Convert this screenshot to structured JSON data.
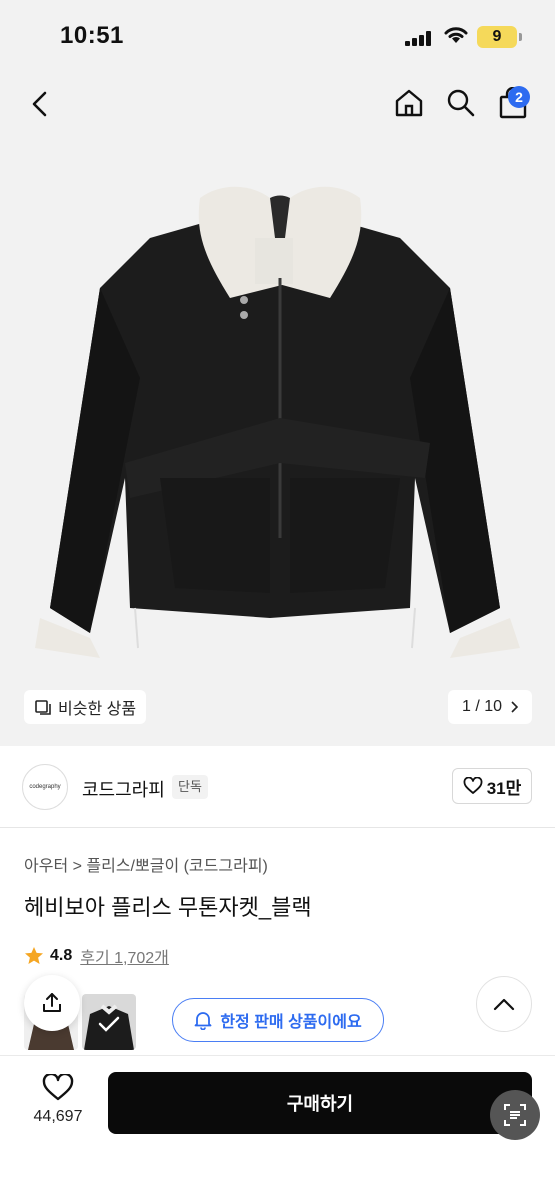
{
  "status": {
    "time": "10:51",
    "battery": "9"
  },
  "header": {
    "cart_count": "2"
  },
  "gallery": {
    "similar_label": "비슷한 상품",
    "pager": "1 / 10"
  },
  "brand": {
    "logo_text": "codegraphy",
    "name": "코드그라피",
    "tag": "단독",
    "likes": "31만"
  },
  "product": {
    "breadcrumb": "아우터 > 플리스/뽀글이 (코드그라피)",
    "title": "헤비보아 플리스 무톤자켓_블랙",
    "rating": "4.8",
    "reviews": "후기 1,702개"
  },
  "notice": {
    "limited_label": "한정 판매 상품이에요"
  },
  "bottom": {
    "wish_count": "44,697",
    "buy_label": "구매하기"
  },
  "colors": {
    "accent": "#2d6bf0",
    "star": "#f5a623",
    "buy_button": "#0a0a0a"
  }
}
